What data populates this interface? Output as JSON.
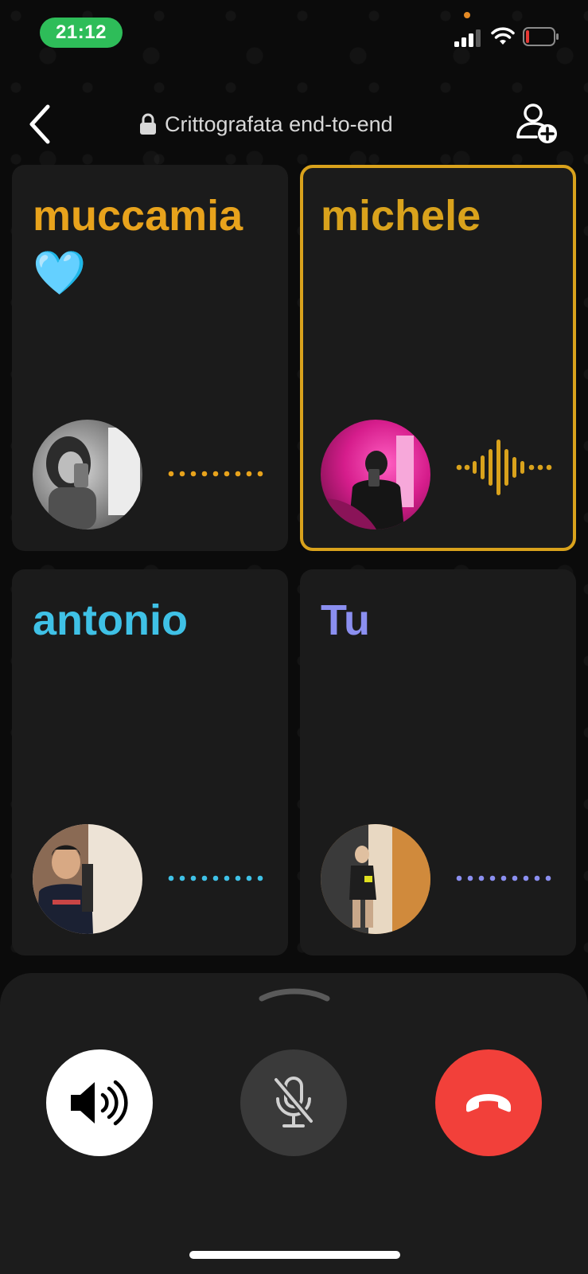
{
  "status_bar": {
    "time": "21:12",
    "signal_icon": "cellular-signal-icon",
    "wifi_icon": "wifi-icon",
    "battery_icon": "battery-low-icon",
    "colors": {
      "time_pill": "#2ebd59",
      "battery_low": "#e53935",
      "privacy_dot": "#e58a25"
    }
  },
  "header": {
    "back_icon": "chevron-left-icon",
    "encryption_label": "Crittografata end-to-end",
    "lock_icon": "lock-icon",
    "add_participant_icon": "add-person-icon"
  },
  "participants": [
    {
      "name": "muccamia🩵",
      "color": "#e8a31c",
      "state": "connecting",
      "speaking": false
    },
    {
      "name": "michele",
      "color": "#d9a21c",
      "state": "speaking",
      "speaking": true
    },
    {
      "name": "antonio",
      "color": "#3fc1e6",
      "state": "connecting",
      "speaking": false
    },
    {
      "name": "Tu",
      "color": "#8b8ff0",
      "state": "connecting",
      "speaking": false
    }
  ],
  "controls": {
    "expand_icon": "chevron-up-icon",
    "speaker_icon": "speaker-icon",
    "mute_icon": "microphone-muted-icon",
    "end_call_icon": "phone-hangup-icon",
    "colors": {
      "speaker_bg": "#ffffff",
      "mute_bg": "#3a3a3a",
      "end_bg": "#f2403a"
    }
  }
}
